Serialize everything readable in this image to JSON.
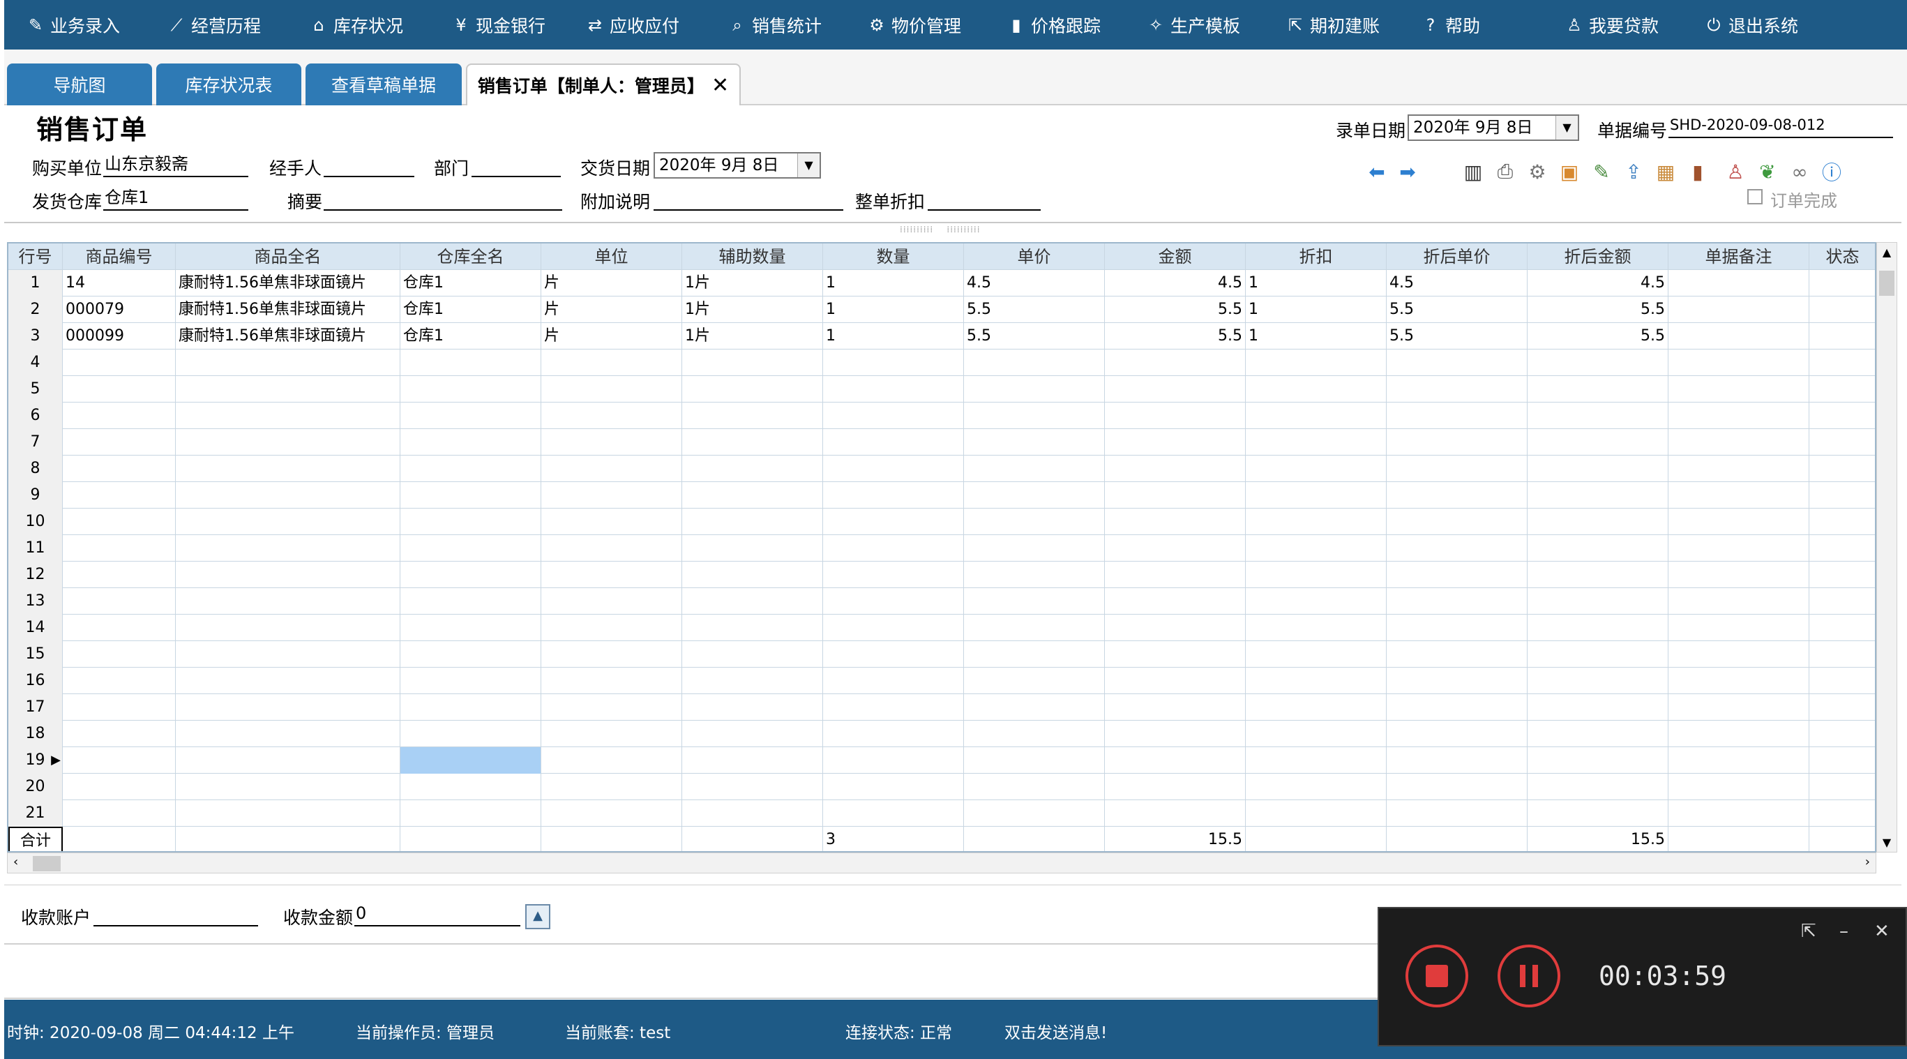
{
  "menu": [
    {
      "label": "业务录入",
      "icon": "edit-icon",
      "glyph": "✎"
    },
    {
      "label": "经营历程",
      "icon": "line-chart-icon",
      "glyph": "⟋"
    },
    {
      "label": "库存状况",
      "icon": "home-icon",
      "glyph": "⌂"
    },
    {
      "label": "现金银行",
      "icon": "yen-icon",
      "glyph": "¥"
    },
    {
      "label": "应收应付",
      "icon": "swap-icon",
      "glyph": "⇄"
    },
    {
      "label": "销售统计",
      "icon": "search-icon",
      "glyph": "⌕"
    },
    {
      "label": "物价管理",
      "icon": "gear-icon",
      "glyph": "⚙"
    },
    {
      "label": "价格跟踪",
      "icon": "bar-chart-icon",
      "glyph": "▮"
    },
    {
      "label": "生产模板",
      "icon": "wrench-icon",
      "glyph": "✧"
    },
    {
      "label": "期初建账",
      "icon": "external-link-icon",
      "glyph": "⇱"
    },
    {
      "label": "帮助",
      "icon": "help-icon",
      "glyph": "?"
    },
    {
      "label": "我要贷款",
      "icon": "user-money-icon",
      "glyph": "♙"
    },
    {
      "label": "退出系统",
      "icon": "power-icon",
      "glyph": "⏻"
    }
  ],
  "tabs": [
    {
      "label": "导航图"
    },
    {
      "label": "库存状况表"
    },
    {
      "label": "查看草稿单据"
    },
    {
      "label": "销售订单【制单人：管理员】",
      "close": "✕"
    }
  ],
  "form": {
    "title": "销售订单",
    "record_date_label": "录单日期",
    "record_date": "2020年 9月 8日",
    "doc_no_label": "单据编号",
    "doc_no": "SHD-2020-09-08-012",
    "buyer_label": "购买单位",
    "buyer": "山东京毅斋",
    "handler_label": "经手人",
    "handler": "",
    "dept_label": "部门",
    "dept": "",
    "delivery_date_label": "交货日期",
    "delivery_date": "2020年 9月 8日",
    "warehouse_label": "发货仓库",
    "warehouse": "仓库1",
    "summary_label": "摘要",
    "summary": "",
    "note_label": "附加说明",
    "note": "",
    "discount_label": "整单折扣",
    "discount": "",
    "order_done_label": "订单完成"
  },
  "toolbar_icons": [
    "arrow-left-icon",
    "arrow-right-icon",
    "barcode-icon",
    "print-icon",
    "settings-icon",
    "add-item-icon",
    "edit-note-icon",
    "export-icon",
    "box-icon",
    "book-icon",
    "user-icon",
    "leaf-icon",
    "link-icon",
    "help-circle-icon"
  ],
  "grid": {
    "columns": [
      "行号",
      "商品编号",
      "商品全名",
      "仓库全名",
      "单位",
      "辅助数量",
      "数量",
      "单价",
      "金额",
      "折扣",
      "折后单价",
      "折后金额",
      "单据备注",
      "状态"
    ],
    "rows": [
      [
        "1",
        "14",
        "康耐特1.56单焦非球面镜片",
        "仓库1",
        "片",
        "1片",
        "1",
        "4.5",
        "4.5",
        "1",
        "4.5",
        "4.5",
        "",
        ""
      ],
      [
        "2",
        "000079",
        "康耐特1.56单焦非球面镜片",
        "仓库1",
        "片",
        "1片",
        "1",
        "5.5",
        "5.5",
        "1",
        "5.5",
        "5.5",
        "",
        ""
      ],
      [
        "3",
        "000099",
        "康耐特1.56单焦非球面镜片",
        "仓库1",
        "片",
        "1片",
        "1",
        "5.5",
        "5.5",
        "1",
        "5.5",
        "5.5",
        "",
        ""
      ],
      [
        "4",
        "",
        "",
        "",
        "",
        "",
        "",
        "",
        "",
        "",
        "",
        "",
        "",
        ""
      ],
      [
        "5",
        "",
        "",
        "",
        "",
        "",
        "",
        "",
        "",
        "",
        "",
        "",
        "",
        ""
      ],
      [
        "6",
        "",
        "",
        "",
        "",
        "",
        "",
        "",
        "",
        "",
        "",
        "",
        "",
        ""
      ],
      [
        "7",
        "",
        "",
        "",
        "",
        "",
        "",
        "",
        "",
        "",
        "",
        "",
        "",
        ""
      ],
      [
        "8",
        "",
        "",
        "",
        "",
        "",
        "",
        "",
        "",
        "",
        "",
        "",
        "",
        ""
      ],
      [
        "9",
        "",
        "",
        "",
        "",
        "",
        "",
        "",
        "",
        "",
        "",
        "",
        "",
        ""
      ],
      [
        "10",
        "",
        "",
        "",
        "",
        "",
        "",
        "",
        "",
        "",
        "",
        "",
        "",
        ""
      ],
      [
        "11",
        "",
        "",
        "",
        "",
        "",
        "",
        "",
        "",
        "",
        "",
        "",
        "",
        ""
      ],
      [
        "12",
        "",
        "",
        "",
        "",
        "",
        "",
        "",
        "",
        "",
        "",
        "",
        "",
        ""
      ],
      [
        "13",
        "",
        "",
        "",
        "",
        "",
        "",
        "",
        "",
        "",
        "",
        "",
        "",
        ""
      ],
      [
        "14",
        "",
        "",
        "",
        "",
        "",
        "",
        "",
        "",
        "",
        "",
        "",
        "",
        ""
      ],
      [
        "15",
        "",
        "",
        "",
        "",
        "",
        "",
        "",
        "",
        "",
        "",
        "",
        "",
        ""
      ],
      [
        "16",
        "",
        "",
        "",
        "",
        "",
        "",
        "",
        "",
        "",
        "",
        "",
        "",
        ""
      ],
      [
        "17",
        "",
        "",
        "",
        "",
        "",
        "",
        "",
        "",
        "",
        "",
        "",
        "",
        ""
      ],
      [
        "18",
        "",
        "",
        "",
        "",
        "",
        "",
        "",
        "",
        "",
        "",
        "",
        "",
        ""
      ],
      [
        "19",
        "",
        "",
        "",
        "",
        "",
        "",
        "",
        "",
        "",
        "",
        "",
        "",
        ""
      ],
      [
        "20",
        "",
        "",
        "",
        "",
        "",
        "",
        "",
        "",
        "",
        "",
        "",
        "",
        ""
      ],
      [
        "21",
        "",
        "",
        "",
        "",
        "",
        "",
        "",
        "",
        "",
        "",
        "",
        "",
        ""
      ]
    ],
    "total": [
      "合计",
      "",
      "",
      "",
      "",
      "",
      "3",
      "",
      "15.5",
      "",
      "",
      "15.5",
      "",
      ""
    ],
    "selected_row": "19",
    "selected_col": 3
  },
  "payment": {
    "account_label": "收款账户",
    "account": "",
    "amount_label": "收款金额",
    "amount": "0"
  },
  "status": {
    "clock": "时钟: 2020-09-08 周二 04:44:12 上午",
    "operator": "当前操作员: 管理员",
    "account_set": "当前账套: test",
    "connection": "连接状态: 正常",
    "message": "双击发送消息!"
  },
  "recorder": {
    "time": "00:03:59"
  },
  "colors": {
    "menu_bg": "#1e5a86",
    "tab_bg": "#2e7ab5",
    "grid_header": "#d8e6f2",
    "selection": "#a9d0f5",
    "record": "#e03c3c"
  }
}
